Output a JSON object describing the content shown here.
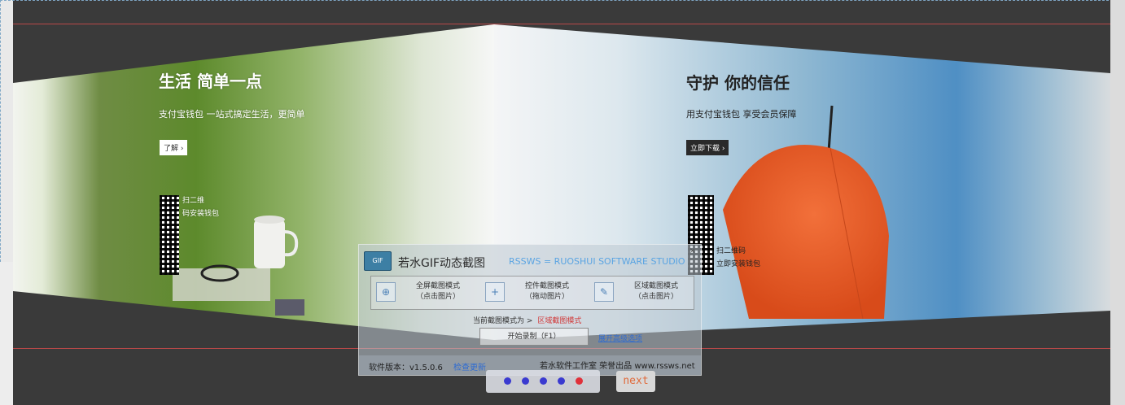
{
  "left_slide": {
    "title": "生活 简单一点",
    "subtitle": "支付宝钱包 一站式搞定生活，更简单",
    "button": "了解 ›",
    "qr_text_1": "扫二维",
    "qr_text_2": "码安装钱包"
  },
  "right_slide": {
    "title": "守护 你的信任",
    "subtitle": "用支付宝钱包 享受会员保障",
    "button": "立即下载 ›",
    "qr_text_1": "扫二维码",
    "qr_text_2": "立即安装钱包"
  },
  "app": {
    "logo_text": "GIF",
    "title": "若水GIF动态截图",
    "brand": "RSSWS = RUOSHUI SOFTWARE STUDIO",
    "close_label": "×",
    "modes": [
      {
        "icon": "fullscreen-icon",
        "glyph": "⊕",
        "line1": "全屏截图模式",
        "line2": "（点击图片）"
      },
      {
        "icon": "window-icon",
        "glyph": "+",
        "line1": "控件截图模式",
        "line2": "（拖动图片）"
      },
      {
        "icon": "region-icon",
        "glyph": "✎",
        "line1": "区域截图模式",
        "line2": "（点击图片）"
      }
    ],
    "current_mode_label": "当前截图模式为 >",
    "current_mode_value": "区域截图模式",
    "record_button": "开始录制（F1）",
    "expand_link": "展开高级选项",
    "version": "软件版本：v1.5.0.6",
    "check_update": "检查更新",
    "studio": "若水软件工作室 荣誉出品 www.rssws.net"
  },
  "pager": {
    "dot_count": 5,
    "active_index": 4,
    "next_label": "next"
  },
  "colors": {
    "panel_bg": "#3a3a3a",
    "accent_red": "#b84848",
    "dot_blue": "#3a3ad0",
    "dot_active": "#e0303a"
  }
}
